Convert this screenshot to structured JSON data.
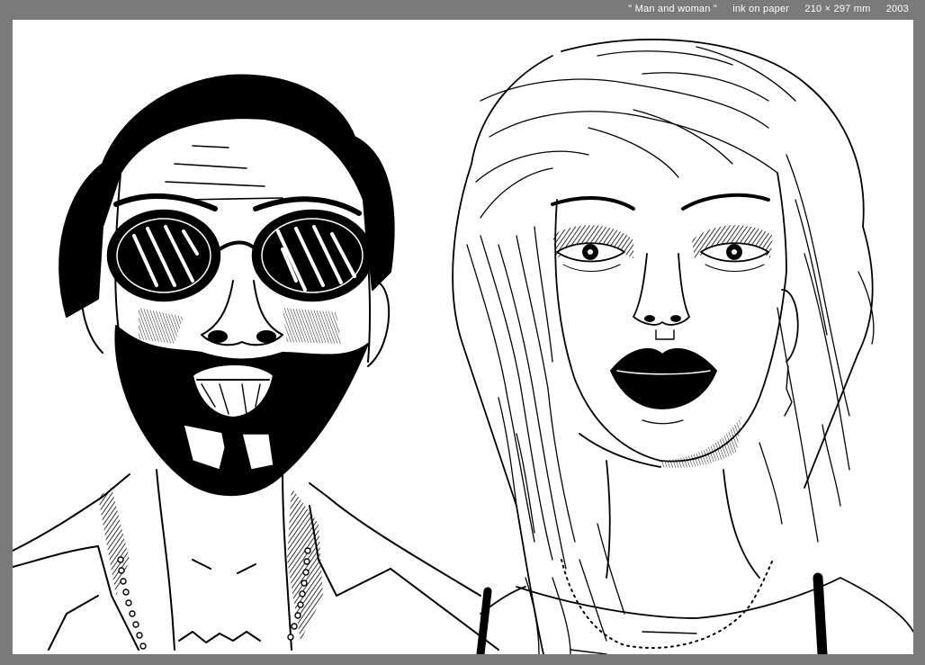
{
  "caption": {
    "title": "\" Man and woman \"",
    "medium": "ink on paper",
    "size": "210 × 297 mm",
    "year": "2003"
  },
  "colors": {
    "frame": "#7a7a7a",
    "paper": "#ffffff",
    "ink": "#000000"
  },
  "artwork": {
    "subjects": [
      "man-portrait",
      "woman-portrait"
    ]
  }
}
